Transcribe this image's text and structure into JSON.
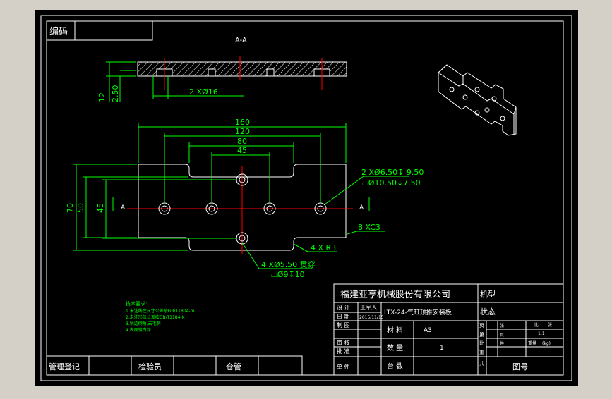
{
  "colors": {
    "background": "#d4d0c8",
    "canvas": "#000000",
    "lines": "#ffffff",
    "dimensions": "#00ff00",
    "centerlines": "#ff0000",
    "hatch": "#ffffff"
  },
  "frame": {
    "code_label": "编码"
  },
  "section_view": {
    "title": "A-A",
    "dim_height": "12",
    "dim_depth": "2.50",
    "holes_label": "2 XØ16"
  },
  "plan_view": {
    "dim_160": "160",
    "dim_120": "120",
    "dim_80": "80",
    "dim_45": "45",
    "dim_70": "70",
    "dim_50": "50",
    "dim_45v": "45",
    "section_mark_left": "A",
    "section_mark_right": "A",
    "callout_holes_1": "2 XØ6.50↧ 9.50",
    "callout_holes_2": "⌴Ø10.50↧7.50",
    "callout_chamfer": "8 XC3",
    "callout_radius": "4 X R3",
    "callout_thru_1": "4 XØ5.50 贯穿",
    "callout_thru_2": "⌴Ø9↧10"
  },
  "tech_notes": {
    "title": "技术要求:",
    "line1": "1.未注线性尺寸公差按GB/T1804-m",
    "line2": "2.未注形位公差按GB/T1184-K",
    "line3": "3.锐边倒角,去毛刺",
    "line4": "4.表面镀白锌"
  },
  "title_block": {
    "company": "福建亚亨机械股份有限公司",
    "model_label": "机型",
    "status_label": "状态",
    "design_label": "设 计",
    "designer": "王军人",
    "date_label": "日 期",
    "date_value": "2015/11/15",
    "part_name": "LTX-24-气缸顶推安装板",
    "draw_label": "制 图",
    "material_label": "材 料",
    "material_value": "A3",
    "audit_label": "审 核",
    "approve_label": "批 准",
    "qty_label": "数 量",
    "qty_value": "1",
    "unit_label": "单 件",
    "sets_label": "台 数",
    "drawing_no_label": "图号",
    "side1": "页",
    "side2": "第",
    "side3": "比",
    "side4": "重",
    "side5": "共",
    "sheet_label": "张",
    "sheet_value": "张",
    "scale_label": "比",
    "scale_value": "1:1",
    "weight_label": "重量",
    "weight_unit": "(kg)",
    "page_label": "页",
    "total_label": "共"
  },
  "bottom_bar": {
    "mgmt": "管理登记",
    "inspector": "检验员",
    "warehouse": "仓管"
  }
}
